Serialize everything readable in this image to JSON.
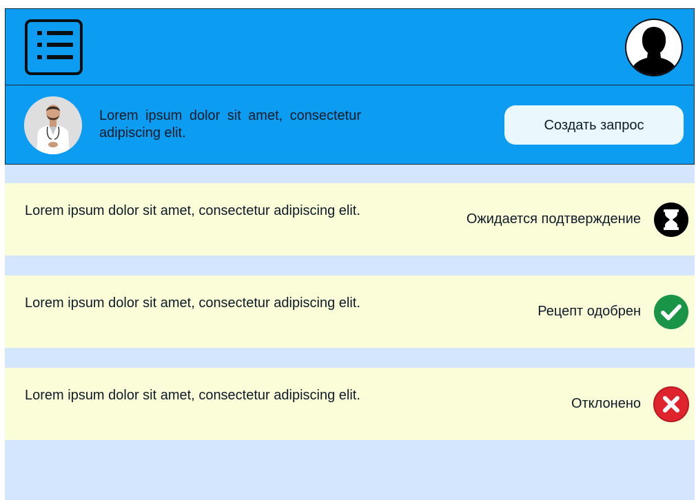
{
  "header": {
    "menu_icon": "menu-list-icon",
    "user_icon": "user-silhouette-icon"
  },
  "profile": {
    "avatar": "doctor-photo",
    "text": "Lorem ipsum dolor sit amet, consectetur adipiscing elit.",
    "create_button_label": "Создать запрос"
  },
  "requests": [
    {
      "text": "Lorem ipsum dolor sit amet, consectetur adipiscing elit.",
      "status": "Ожидается подтверждение",
      "icon": "hourglass-icon"
    },
    {
      "text": "Lorem ipsum dolor sit amet, consectetur adipiscing elit.",
      "status": "Рецепт одобрен",
      "icon": "check-icon"
    },
    {
      "text": "Lorem ipsum dolor sit amet, consectetur adipiscing elit.",
      "status": "Отклонено",
      "icon": "cross-icon"
    }
  ],
  "colors": {
    "header_bg": "#0c9cf2",
    "page_bg": "#d3e6fd",
    "card_bg": "#fbfcd8",
    "approved": "#1a9447",
    "rejected": "#e0242e"
  }
}
